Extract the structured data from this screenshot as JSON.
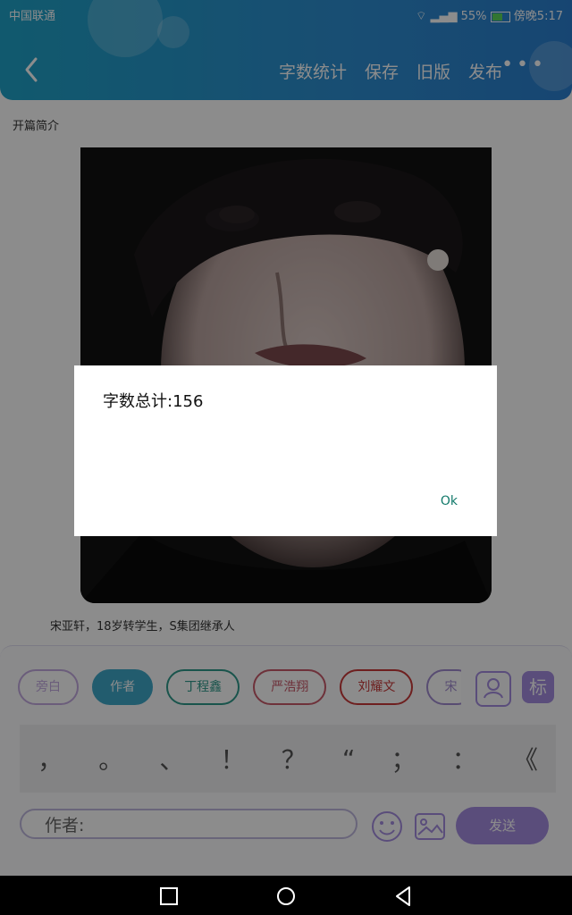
{
  "status_bar": {
    "carrier": "中国联通",
    "battery": "55%",
    "time": "傍晚5:17"
  },
  "header": {
    "actions": [
      "字数统计",
      "保存",
      "旧版",
      "发布"
    ],
    "more": "•••"
  },
  "content": {
    "section_title": "开篇简介",
    "caption": "宋亚轩，18岁转学生，S集团继承人"
  },
  "roles": [
    {
      "label": "旁白",
      "color": "#c3a9e0"
    },
    {
      "label": "作者",
      "color": "#3ea8c8"
    },
    {
      "label": "丁程鑫",
      "color": "#2f9a8a"
    },
    {
      "label": "严浩翔",
      "color": "#c85a6a"
    },
    {
      "label": "刘耀文",
      "color": "#c83a3a"
    },
    {
      "label": "宋",
      "color": "#a08ad0"
    }
  ],
  "punctuation": [
    "，",
    "。",
    "、",
    "！",
    "？",
    "“",
    "；",
    "：",
    "《"
  ],
  "composer": {
    "prefix": "作者:",
    "send_label": "发送"
  },
  "dialog": {
    "message": "字数总计:156",
    "ok_label": "Ok"
  },
  "icons": {
    "badge_label": "标",
    "names": [
      "back-icon",
      "wifi-icon",
      "signal-icon",
      "battery-icon",
      "person-icon",
      "tag-icon",
      "emoji-icon",
      "image-icon",
      "home-icon",
      "recent-icon",
      "nav-back-icon"
    ]
  }
}
